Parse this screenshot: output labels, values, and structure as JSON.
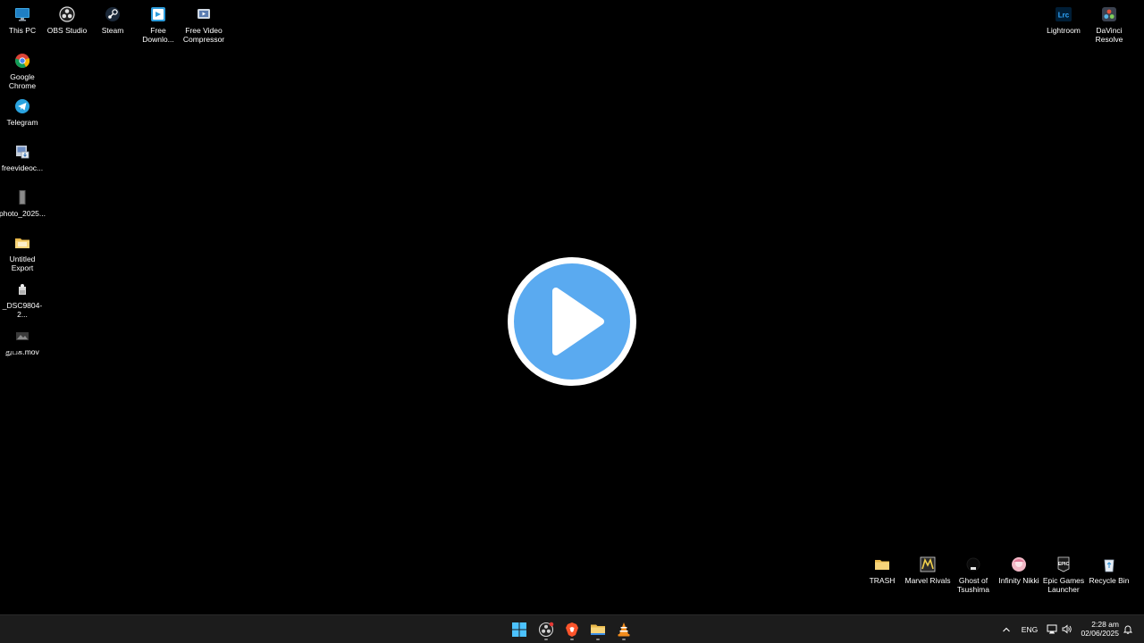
{
  "desktop": {
    "icons_left_top_row": [
      {
        "label": "This PC",
        "icon": "monitor-icon"
      },
      {
        "label": "OBS Studio",
        "icon": "obs-icon"
      },
      {
        "label": "Steam",
        "icon": "steam-icon"
      },
      {
        "label": "Free Downlo...",
        "icon": "download-app-icon"
      },
      {
        "label": "Free Video Compressor",
        "icon": "video-compressor-icon"
      }
    ],
    "icons_left_column": [
      {
        "label": "Google Chrome",
        "icon": "chrome-icon"
      },
      {
        "label": "Telegram",
        "icon": "telegram-icon"
      },
      {
        "label": "freevideoc...",
        "icon": "installer-icon"
      },
      {
        "label": "photo_2025...",
        "icon": "photo-file-icon"
      },
      {
        "label": "Untitled Export",
        "icon": "folder-icon"
      },
      {
        "label": "_DSC9804-2...",
        "icon": "image-file-icon"
      },
      {
        "label": "துபக.mov",
        "icon": "video-file-icon"
      }
    ],
    "icons_right_top": [
      {
        "label": "Lightroom",
        "icon": "lightroom-icon"
      },
      {
        "label": "DaVinci Resolve",
        "icon": "davinci-icon"
      }
    ],
    "icons_bottom_right": [
      {
        "label": "TRASH",
        "icon": "folder-icon"
      },
      {
        "label": "Marvel Rivals",
        "icon": "marvel-rivals-icon"
      },
      {
        "label": "Ghost of Tsushima",
        "icon": "ghost-icon"
      },
      {
        "label": "Infinity Nikki",
        "icon": "infinity-nikki-icon"
      },
      {
        "label": "Epic Games Launcher",
        "icon": "epic-games-icon"
      },
      {
        "label": "Recycle Bin",
        "icon": "recycle-bin-icon"
      }
    ],
    "lightroom_badge": "Lrc",
    "epic_badge": "EPIC"
  },
  "taskbar": {
    "apps": [
      {
        "name": "start",
        "icon": "windows-start-icon"
      },
      {
        "name": "obs",
        "icon": "obs-icon"
      },
      {
        "name": "brave",
        "icon": "brave-icon"
      },
      {
        "name": "explorer",
        "icon": "folder-icon"
      },
      {
        "name": "vlc",
        "icon": "vlc-icon"
      }
    ],
    "tray": {
      "language": "ENG",
      "time": "2:28 am",
      "date": "02/06/2025"
    }
  },
  "colors": {
    "play_button": "#5aaaf0",
    "taskbar": "#1c1c1c",
    "folder": "#f2c94c",
    "lightroom": "#1e3a5f"
  }
}
